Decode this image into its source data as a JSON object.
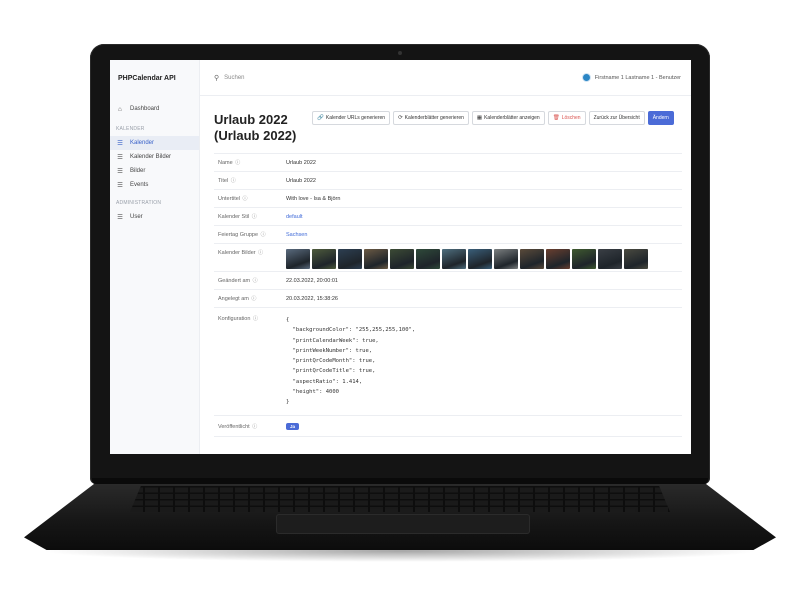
{
  "app": {
    "title": "PHPCalendar API"
  },
  "search": {
    "placeholder": "Suchen"
  },
  "user": {
    "label": "Firstname 1 Lastname 1 - Benutzer"
  },
  "sidebar": {
    "dashboard": "Dashboard",
    "section_calendar": "KALENDER",
    "calendar_items": [
      {
        "label": "Kalender",
        "icon": "list-icon",
        "active": true
      },
      {
        "label": "Kalender Bilder",
        "icon": "list-icon",
        "active": false
      },
      {
        "label": "Bilder",
        "icon": "list-icon",
        "active": false
      },
      {
        "label": "Events",
        "icon": "list-icon",
        "active": false
      }
    ],
    "section_admin": "ADMINISTRATION",
    "admin_items": [
      {
        "label": "User",
        "icon": "list-icon",
        "active": false
      }
    ]
  },
  "page": {
    "title_line1": "Urlaub 2022",
    "title_line2": "(Urlaub 2022)",
    "buttons": {
      "urls": "Kalender URLs generieren",
      "generate": "Kalenderblätter generieren",
      "show": "Kalenderblätter anzeigen",
      "delete": "Löschen",
      "back": "Zurück zur Übersicht",
      "edit": "Ändern"
    }
  },
  "details": {
    "name": {
      "label": "Name",
      "value": "Urlaub 2022"
    },
    "title": {
      "label": "Titel",
      "value": "Urlaub 2022"
    },
    "subtitle": {
      "label": "Untertitel",
      "value": "With love - Isa & Björn"
    },
    "style": {
      "label": "Kalender Stil",
      "value": "default"
    },
    "holiday": {
      "label": "Feiertag Gruppe",
      "value": "Sachsen"
    },
    "images": {
      "label": "Kalender Bilder"
    },
    "changed": {
      "label": "Geändert am",
      "value": "22.03.2022, 20:00:01"
    },
    "created": {
      "label": "Angelegt am",
      "value": "20.03.2022, 15:38:26"
    },
    "config": {
      "label": "Konfiguration",
      "value": "{\n  \"backgroundColor\": \"255,255,255,100\",\n  \"printCalendarWeek\": true,\n  \"printWeekNumber\": true,\n  \"printQrCodeMonth\": true,\n  \"printQrCodeTitle\": true,\n  \"aspectRatio\": 1.414,\n  \"height\": 4000\n}"
    },
    "published": {
      "label": "Veröffentlicht",
      "value": "Ja"
    }
  },
  "thumbnail_colors": [
    "#5a6b7e",
    "#4e5b3c",
    "#2d3f52",
    "#6b5a44",
    "#3c4b35",
    "#2f4a3a",
    "#4f6f7f",
    "#3a5f7a",
    "#7b7f80",
    "#5a4a3a",
    "#6a3f2f",
    "#3f5a2f",
    "#3a3f45",
    "#4a4a40"
  ]
}
